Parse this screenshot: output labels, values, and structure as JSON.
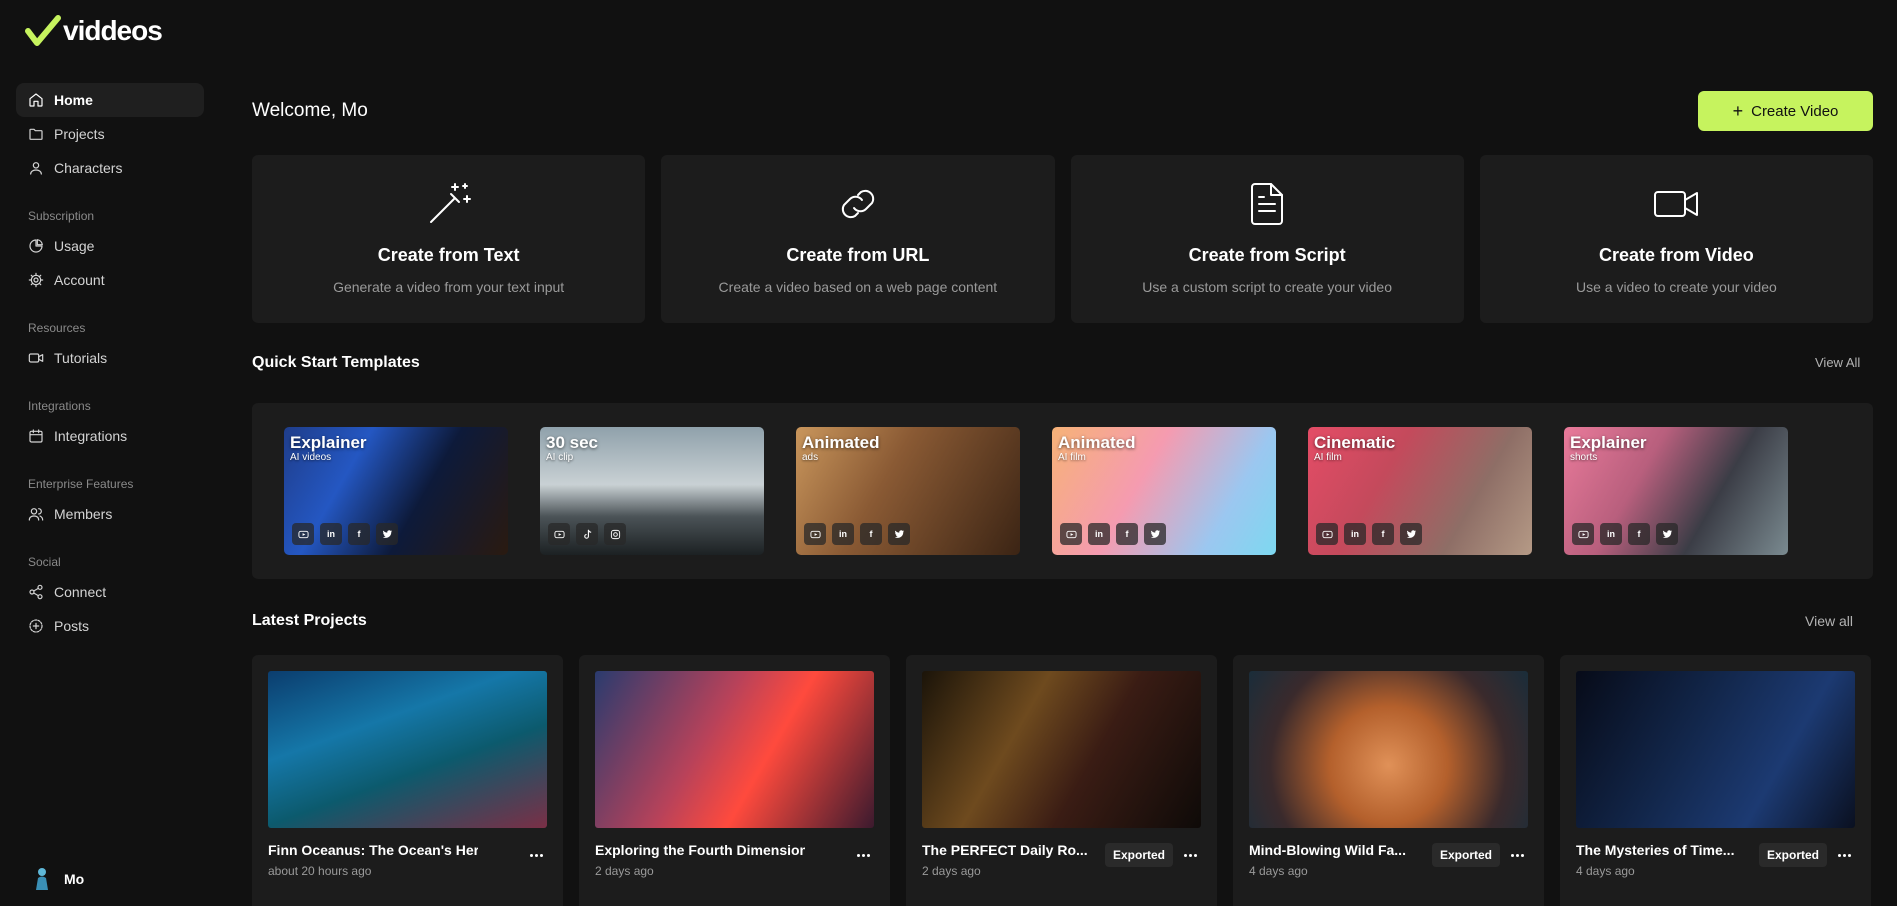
{
  "brand": {
    "name": "viddeos",
    "accent": "#c6f35e"
  },
  "sidebar": {
    "groups": [
      {
        "section": "",
        "items": [
          {
            "label": "Home",
            "icon": "home-icon",
            "active": true
          },
          {
            "label": "Projects",
            "icon": "folder-icon"
          },
          {
            "label": "Characters",
            "icon": "user-icon"
          }
        ]
      },
      {
        "section": "Subscription",
        "items": [
          {
            "label": "Usage",
            "icon": "pie-chart-icon"
          },
          {
            "label": "Account",
            "icon": "gear-icon"
          }
        ]
      },
      {
        "section": "Resources",
        "items": [
          {
            "label": "Tutorials",
            "icon": "video-icon"
          }
        ]
      },
      {
        "section": "Integrations",
        "items": [
          {
            "label": "Integrations",
            "icon": "calendar-icon"
          }
        ]
      },
      {
        "section": "Enterprise Features",
        "items": [
          {
            "label": "Members",
            "icon": "users-icon"
          }
        ]
      },
      {
        "section": "Social",
        "items": [
          {
            "label": "Connect",
            "icon": "share-icon"
          },
          {
            "label": "Posts",
            "icon": "plus-circle-icon"
          }
        ]
      }
    ],
    "user": {
      "name": "Mo"
    }
  },
  "header": {
    "welcome": "Welcome, Mo",
    "create_button": "Create Video"
  },
  "create_cards": [
    {
      "title": "Create from Text",
      "desc": "Generate a video from your text input",
      "icon": "magic-wand-icon"
    },
    {
      "title": "Create from URL",
      "desc": "Create a video based on a web page content",
      "icon": "link-icon"
    },
    {
      "title": "Create from Script",
      "desc": "Use a custom script to create your video",
      "icon": "document-icon"
    },
    {
      "title": "Create from Video",
      "desc": "Use a video to create your video",
      "icon": "video-camera-icon"
    }
  ],
  "templates": {
    "title": "Quick Start Templates",
    "view_all": "View All",
    "items": [
      {
        "title": "Explainer",
        "sub": "AI videos",
        "socials": [
          "youtube",
          "linkedin",
          "facebook",
          "twitter"
        ],
        "bg": "linear-gradient(120deg,#1f3d8a 0%,#2457c2 30%,#0d1a3a 60%,#2a1a10 100%)"
      },
      {
        "title": "30 sec",
        "sub": "AI clip",
        "socials": [
          "youtube",
          "tiktok",
          "instagram"
        ],
        "bg": "linear-gradient(180deg,#8fa1ab 0%,#c9d1d4 45%,#4b5357 70%,#1c2123 100%)"
      },
      {
        "title": "Animated",
        "sub": "ads",
        "socials": [
          "youtube",
          "linkedin",
          "facebook",
          "twitter"
        ],
        "bg": "linear-gradient(120deg,#c9965c 0%,#8a5a34 40%,#3b2414 100%)"
      },
      {
        "title": "Animated",
        "sub": "AI film",
        "socials": [
          "youtube",
          "linkedin",
          "facebook",
          "twitter"
        ],
        "bg": "linear-gradient(120deg,#f6b277 0%,#f59bb0 40%,#9bc7f0 75%,#7dd8f0 100%)"
      },
      {
        "title": "Cinematic",
        "sub": "AI film",
        "socials": [
          "youtube",
          "linkedin",
          "facebook",
          "twitter"
        ],
        "bg": "linear-gradient(120deg,#e44c66 0%,#c44a5c 35%,#8e6e66 70%,#b59a86 100%)"
      },
      {
        "title": "Explainer",
        "sub": "shorts",
        "socials": [
          "youtube",
          "linkedin",
          "facebook",
          "twitter"
        ],
        "bg": "linear-gradient(120deg,#e97a9a 0%,#b85f7d 35%,#3b3d46 65%,#7a8a90 100%)"
      }
    ]
  },
  "projects": {
    "title": "Latest Projects",
    "view_all": "View all",
    "items": [
      {
        "title": "Finn Oceanus: The Ocean's Hero",
        "time": "about 20 hours ago",
        "badge": "",
        "bg": "linear-gradient(160deg,#0b3d6e 0%,#1577a8 35%,#0c5a6d 60%,#7a2f46 100%)"
      },
      {
        "title": "Exploring the Fourth Dimension",
        "time": "2 days ago",
        "badge": "",
        "bg": "linear-gradient(120deg,#2a3b6e 0%,#b7425a 40%,#ff4a3d 60%,#3b1a2e 100%)"
      },
      {
        "title": "The PERFECT Daily Ro...",
        "time": "2 days ago",
        "badge": "Exported",
        "bg": "linear-gradient(120deg,#1b1409 0%,#6e4a1e 35%,#3a1c14 60%,#0e0a08 100%)"
      },
      {
        "title": "Mind-Blowing Wild Fa...",
        "time": "4 days ago",
        "badge": "Exported",
        "bg": "radial-gradient(circle at 50% 60%,#e09158 0%,#b4602c 35%,#3a2a2c 70%,#1a2d3a 100%)"
      },
      {
        "title": "The Mysteries of Time...",
        "time": "4 days ago",
        "badge": "Exported",
        "bg": "linear-gradient(120deg,#070b18 0%,#12264a 40%,#1c3a72 70%,#0a1020 100%)"
      }
    ]
  }
}
